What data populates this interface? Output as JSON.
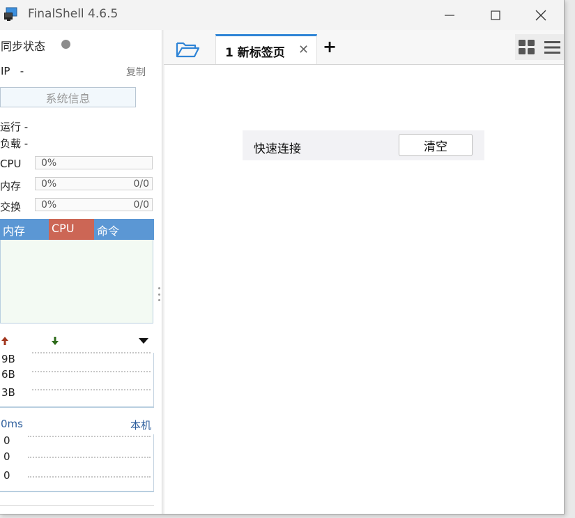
{
  "window": {
    "title": "FinalShell 4.6.5"
  },
  "left": {
    "sync_label": "同步状态",
    "ip_label": "IP",
    "ip_value": "-",
    "copy_label": "复制",
    "sysinfo_label": "系统信息",
    "run_label": "运行 -",
    "load_label": "负载 -",
    "cpu": {
      "label": "CPU",
      "percent": "0%"
    },
    "mem": {
      "label": "内存",
      "percent": "0%",
      "total": "0/0"
    },
    "swap": {
      "label": "交换",
      "percent": "0%",
      "total": "0/0"
    },
    "proc_columns": [
      "内存",
      "CPU",
      "命令"
    ],
    "net_rows": [
      "9B",
      "6B",
      "3B"
    ],
    "ping_label": "0ms",
    "ping_target": "本机",
    "ping_rows": [
      "0",
      "0",
      "0"
    ]
  },
  "tabs": [
    {
      "label": "1 新标签页",
      "active": true
    }
  ],
  "main": {
    "quick_connect_label": "快速连接",
    "clear_label": "清空"
  },
  "colors": {
    "accent": "#2f84d6",
    "proc_mem_col": "#5b97d4",
    "proc_cpu_col": "#cc6655",
    "proc_cmd_col": "#5b97d4",
    "upload_arrow": "#a1361e",
    "download_arrow": "#2e6b1a"
  },
  "icons": {
    "app": "monitor-icon",
    "folder": "folder-open-icon",
    "grid": "grid-view-icon",
    "menu": "hamburger-menu-icon"
  }
}
